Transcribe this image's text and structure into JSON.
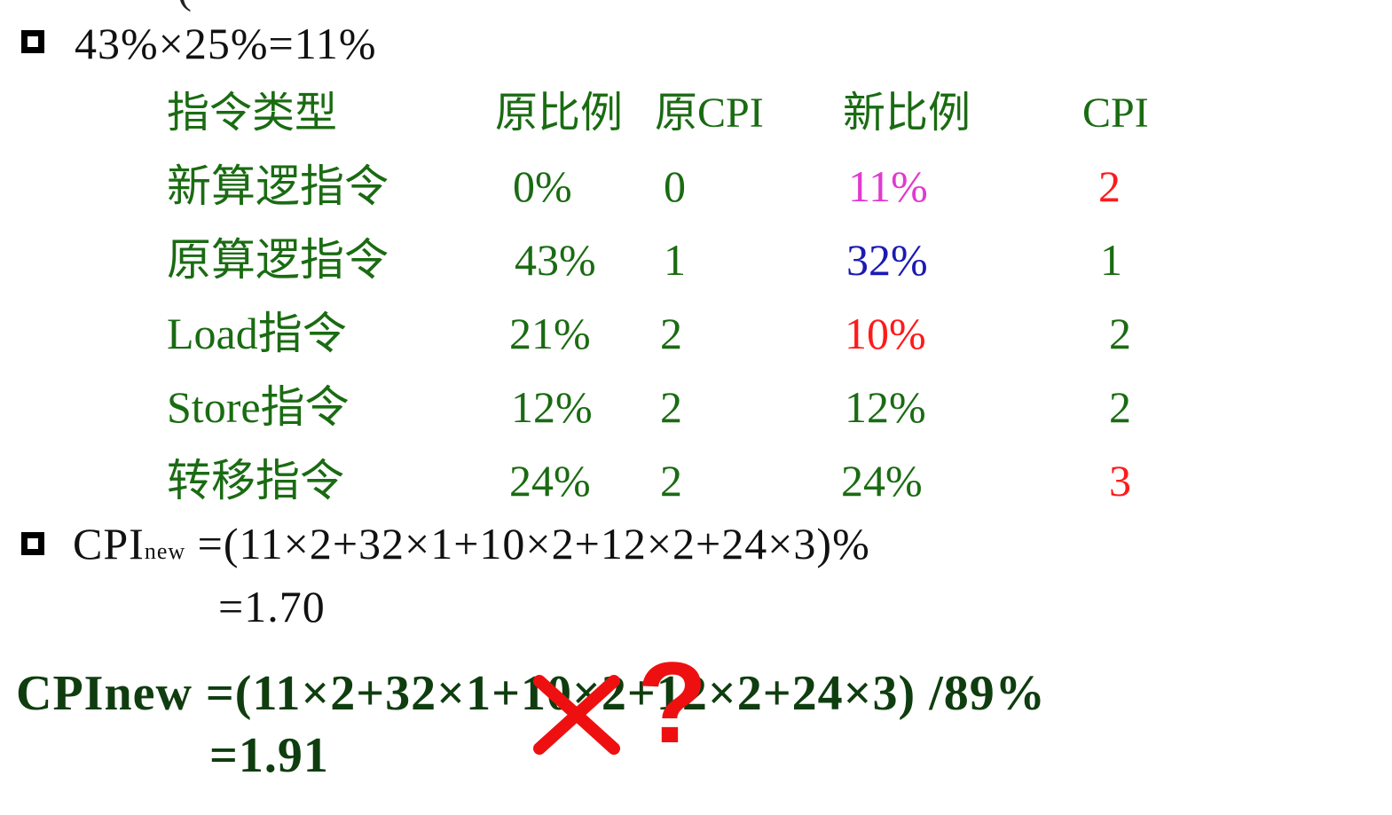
{
  "line1": "43%×25%=11%",
  "table": {
    "headers": [
      "指令类型",
      "原比例",
      "原CPI",
      "新比例",
      "CPI"
    ],
    "rows": [
      {
        "type": "新算逻指令",
        "orig_ratio": "0%",
        "orig_cpi": "0",
        "new_ratio": "11%",
        "cpi": "2",
        "new_ratio_color": "#e03ad0",
        "cpi_color": "#ff1a1a"
      },
      {
        "type": "原算逻指令",
        "orig_ratio": "43%",
        "orig_cpi": "1",
        "new_ratio": "32%",
        "cpi": "1",
        "new_ratio_color": "#1a1ab5",
        "cpi_color": "#1a6b12"
      },
      {
        "type": "Load指令",
        "orig_ratio": "21%",
        "orig_cpi": "2",
        "new_ratio": "10%",
        "cpi": "2",
        "new_ratio_color": "#ff1a1a",
        "cpi_color": "#1a6b12"
      },
      {
        "type": "Store指令",
        "orig_ratio": "12%",
        "orig_cpi": "2",
        "new_ratio": "12%",
        "cpi": "2",
        "new_ratio_color": "#1a6b12",
        "cpi_color": "#1a6b12"
      },
      {
        "type": "转移指令",
        "orig_ratio": "24%",
        "orig_cpi": "2",
        "new_ratio": "24%",
        "cpi": "3",
        "new_ratio_color": "#1a6b12",
        "cpi_color": "#ff1a1a"
      }
    ]
  },
  "formula1": {
    "cpi": "CPI",
    "sub": "new",
    "expr": " =(11×2+32×1+10×2+12×2+24×3)%",
    "result": "=1.70"
  },
  "formula2": {
    "expr": "CPInew =(11×2+32×1+10×2+12×2+24×3) /89%",
    "result": "=1.91"
  },
  "marks": {
    "cross": "cross-mark",
    "question": "?"
  },
  "colors": {
    "table_text": "#1a6b12",
    "formula2": "#0f3d0f",
    "mark": "#ee1010"
  }
}
